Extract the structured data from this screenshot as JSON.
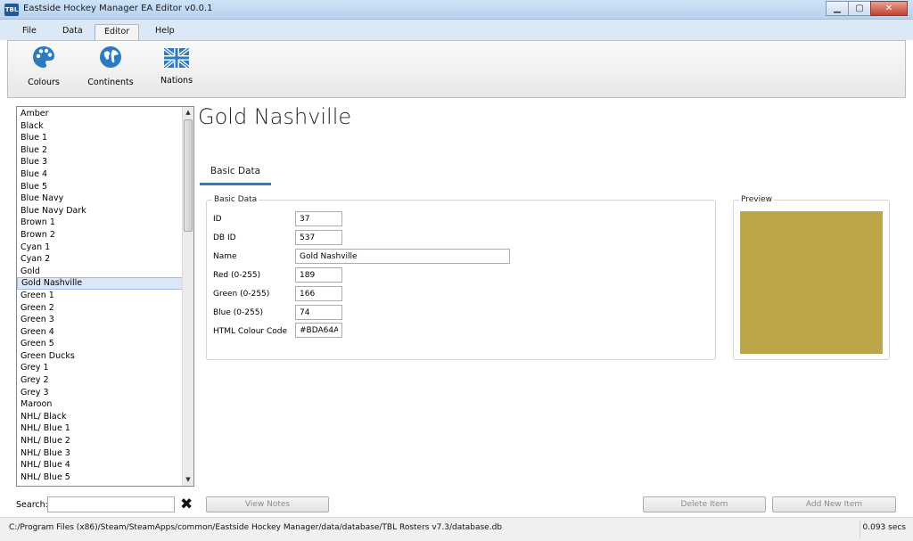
{
  "window": {
    "app_icon_text": "TBL",
    "title": "Eastside Hockey Manager EA Editor v0.0.1"
  },
  "ribbon": {
    "tabs": [
      "File",
      "Data",
      "Editor",
      "Help"
    ],
    "active_tab": "Editor",
    "items": [
      {
        "label": "Colours",
        "icon": "palette-icon"
      },
      {
        "label": "Continents",
        "icon": "globe-icon"
      },
      {
        "label": "Nations",
        "icon": "union-jack-flag-icon"
      }
    ]
  },
  "list": {
    "items": [
      "Amber",
      "Black",
      "Blue 1",
      "Blue 2",
      "Blue 3",
      "Blue 4",
      "Blue 5",
      "Blue Navy",
      "Blue Navy Dark",
      "Brown 1",
      "Brown 2",
      "Cyan 1",
      "Cyan 2",
      "Gold",
      "Gold Nashville",
      "Green 1",
      "Green 2",
      "Green 3",
      "Green 4",
      "Green 5",
      "Green Ducks",
      "Grey 1",
      "Grey 2",
      "Grey 3",
      "Maroon",
      "NHL/ Black",
      "NHL/ Blue 1",
      "NHL/ Blue 2",
      "NHL/ Blue 3",
      "NHL/ Blue 4",
      "NHL/ Blue 5"
    ],
    "selected": "Gold Nashville"
  },
  "detail": {
    "title": "Gold Nashville",
    "tab": "Basic Data",
    "group_label": "Basic Data",
    "fields": {
      "id": {
        "label": "ID",
        "value": "37"
      },
      "db_id": {
        "label": "DB ID",
        "value": "537"
      },
      "name": {
        "label": "Name",
        "value": "Gold Nashville"
      },
      "red": {
        "label": "Red (0-255)",
        "value": "189"
      },
      "green": {
        "label": "Green (0-255)",
        "value": "166"
      },
      "blue": {
        "label": "Blue (0-255)",
        "value": "74"
      },
      "html": {
        "label": "HTML Colour Code",
        "value": "#BDA64A"
      }
    },
    "preview_label": "Preview",
    "preview_color": "#BDA64A"
  },
  "bottom": {
    "search_label": "Search:",
    "search_value": "",
    "view_notes": "View Notes",
    "delete_item": "Delete Item",
    "add_new_item": "Add New Item"
  },
  "status": {
    "path": "C:/Program Files (x86)/Steam/SteamApps/common/Eastside Hockey Manager/data/database/TBL Rosters v7.3/database.db",
    "time": "0.093 secs"
  }
}
